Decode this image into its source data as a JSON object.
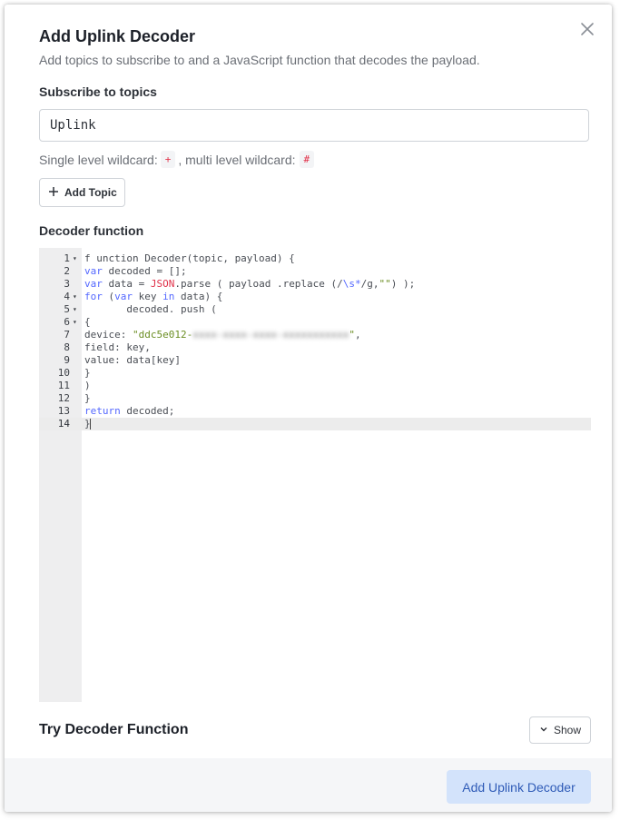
{
  "dialog": {
    "title": "Add Uplink Decoder",
    "subtitle": "Add topics to subscribe to and a JavaScript function that decodes the payload.",
    "close_icon": "close-icon"
  },
  "topics": {
    "label": "Subscribe to topics",
    "value": "Uplink",
    "hint_prefix": "Single level wildcard:",
    "single_wildcard": "+",
    "hint_middle": ", multi level wildcard:",
    "multi_wildcard": "#",
    "add_button_label": "Add Topic",
    "add_icon": "plus-icon"
  },
  "decoder": {
    "label": "Decoder function",
    "lines": [
      {
        "n": "1",
        "fold": true,
        "segments": [
          {
            "t": "f unction Decoder(topic, payload) {",
            "c": ""
          }
        ]
      },
      {
        "n": "2",
        "fold": false,
        "segments": [
          {
            "t": "var",
            "c": "kw"
          },
          {
            "t": " decoded = [];",
            "c": ""
          }
        ]
      },
      {
        "n": "3",
        "fold": false,
        "segments": [
          {
            "t": "var",
            "c": "kw"
          },
          {
            "t": " data = ",
            "c": ""
          },
          {
            "t": "JSON",
            "c": "bi"
          },
          {
            "t": ".parse ( payload .replace (/",
            "c": ""
          },
          {
            "t": "\\s*",
            "c": "kw"
          },
          {
            "t": "/g,",
            "c": ""
          },
          {
            "t": "\"\"",
            "c": "str"
          },
          {
            "t": ") );",
            "c": ""
          }
        ]
      },
      {
        "n": "4",
        "fold": true,
        "segments": [
          {
            "t": "for",
            "c": "kw"
          },
          {
            "t": " (",
            "c": ""
          },
          {
            "t": "var",
            "c": "kw"
          },
          {
            "t": " key ",
            "c": ""
          },
          {
            "t": "in",
            "c": "kw"
          },
          {
            "t": " data) {",
            "c": ""
          }
        ]
      },
      {
        "n": "5",
        "fold": true,
        "segments": [
          {
            "t": "       decoded. push (",
            "c": ""
          }
        ]
      },
      {
        "n": "6",
        "fold": true,
        "segments": [
          {
            "t": "{",
            "c": ""
          }
        ]
      },
      {
        "n": "7",
        "fold": false,
        "segments": [
          {
            "t": "device: ",
            "c": ""
          },
          {
            "t": "\"ddc5e012-",
            "c": "str"
          },
          {
            "t": "xxxx-xxxx-xxxx-xxxxxxxxxxx",
            "c": "blur"
          },
          {
            "t": "\"",
            "c": "str"
          },
          {
            "t": ",",
            "c": ""
          }
        ]
      },
      {
        "n": "8",
        "fold": false,
        "segments": [
          {
            "t": "field: key,",
            "c": ""
          }
        ]
      },
      {
        "n": "9",
        "fold": false,
        "segments": [
          {
            "t": "value: data[key]",
            "c": ""
          }
        ]
      },
      {
        "n": "10",
        "fold": false,
        "segments": [
          {
            "t": "}",
            "c": ""
          }
        ]
      },
      {
        "n": "11",
        "fold": false,
        "segments": [
          {
            "t": ")",
            "c": ""
          }
        ]
      },
      {
        "n": "12",
        "fold": false,
        "segments": [
          {
            "t": "}",
            "c": ""
          }
        ]
      },
      {
        "n": "13",
        "fold": false,
        "segments": [
          {
            "t": "return",
            "c": "kw"
          },
          {
            "t": " decoded;",
            "c": ""
          }
        ]
      },
      {
        "n": "14",
        "fold": false,
        "active": true,
        "segments": [
          {
            "t": "}",
            "c": ""
          }
        ]
      }
    ]
  },
  "try_section": {
    "label": "Try Decoder Function",
    "show_label": "Show",
    "chevron_icon": "chevron-down-icon"
  },
  "footer": {
    "primary_label": "Add Uplink Decoder"
  },
  "colors": {
    "primary_bg": "#d3e3fb",
    "primary_text": "#2f5bb7",
    "keyword": "#5468ff",
    "builtin": "#e0324a",
    "string": "#6b8e23",
    "wildcard_chip": "#e2324a"
  }
}
